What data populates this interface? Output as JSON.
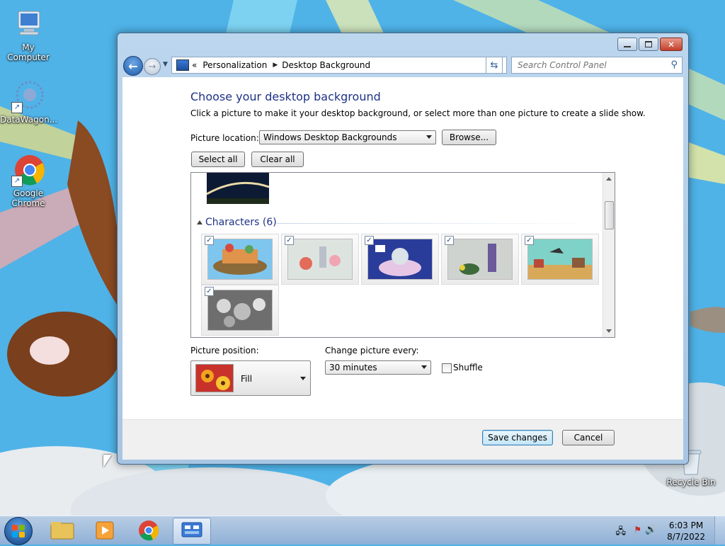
{
  "desktop": {
    "icons": [
      {
        "label": "My Computer"
      },
      {
        "label": "DataWagon..."
      },
      {
        "label": "Google\nChrome"
      },
      {
        "label": "Recycle Bin"
      }
    ]
  },
  "window": {
    "address": {
      "prefix": "«",
      "segments": [
        "Personalization",
        "Desktop Background"
      ]
    },
    "search": {
      "placeholder": "Search Control Panel"
    },
    "heading": "Choose your desktop background",
    "subtext": "Click a picture to make it your desktop background, or select more than one picture to create a slide show.",
    "picture_location": {
      "label": "Picture location:",
      "value": "Windows Desktop Backgrounds",
      "browse": "Browse..."
    },
    "select_all": "Select all",
    "clear_all": "Clear all",
    "gallery": {
      "group_title": "Characters (6)",
      "items_checked": [
        true,
        true,
        true,
        true,
        true,
        true
      ]
    },
    "picture_position": {
      "label": "Picture position:",
      "value": "Fill"
    },
    "change_picture": {
      "label": "Change picture every:",
      "value": "30 minutes"
    },
    "shuffle": {
      "label": "Shuffle",
      "checked": false
    },
    "save": "Save changes",
    "cancel": "Cancel"
  },
  "taskbar": {
    "time": "6:03 PM",
    "date": "8/7/2022"
  },
  "colors": {
    "heading": "#1e3287",
    "desktop_sky": "#4fb3e8"
  }
}
